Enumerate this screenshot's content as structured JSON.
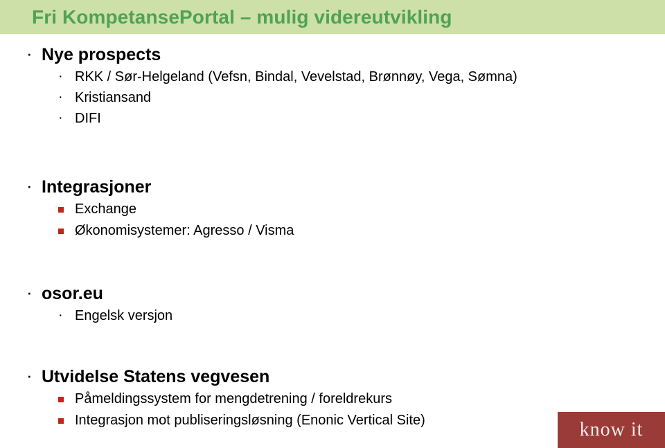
{
  "slide": {
    "title": "Fri KompetansePortal – mulig videreutvikling",
    "title_bg_color": "#CDE0A8",
    "title_text_color": "#4FA352",
    "square_bullet_color": "#C0271A",
    "dot_bullet_glyph": "·",
    "blocks": [
      {
        "id": "prospects",
        "heading": "Nye prospects",
        "items": [
          {
            "text": "RKK / Sør-Helgeland (Vefsn, Bindal, Vevelstad, Brønnøy, Vega, Sømna)",
            "marker": "dot"
          },
          {
            "text": "Kristiansand",
            "marker": "dot"
          },
          {
            "text": "DIFI",
            "marker": "dot"
          }
        ]
      },
      {
        "id": "integrasjon",
        "heading": "Integrasjoner",
        "items": [
          {
            "text": "Exchange",
            "marker": "square"
          },
          {
            "text": "Økonomisystemer: Agresso / Visma",
            "marker": "square"
          }
        ]
      },
      {
        "id": "osor",
        "heading": "osor.eu",
        "items": [
          {
            "text": "Engelsk versjon",
            "marker": "dot"
          }
        ]
      },
      {
        "id": "vegvesen",
        "heading": "Utvidelse Statens vegvesen",
        "items": [
          {
            "text": "Påmeldingssystem for mengdetrening / foreldrekurs",
            "marker": "square"
          },
          {
            "text": "Integrasjon mot publiseringsløsning (Enonic Vertical Site)",
            "marker": "square"
          }
        ]
      }
    ]
  },
  "logo": {
    "text": "know it",
    "bg_color": "#9B3B37",
    "text_color": "#F3ECE8"
  }
}
